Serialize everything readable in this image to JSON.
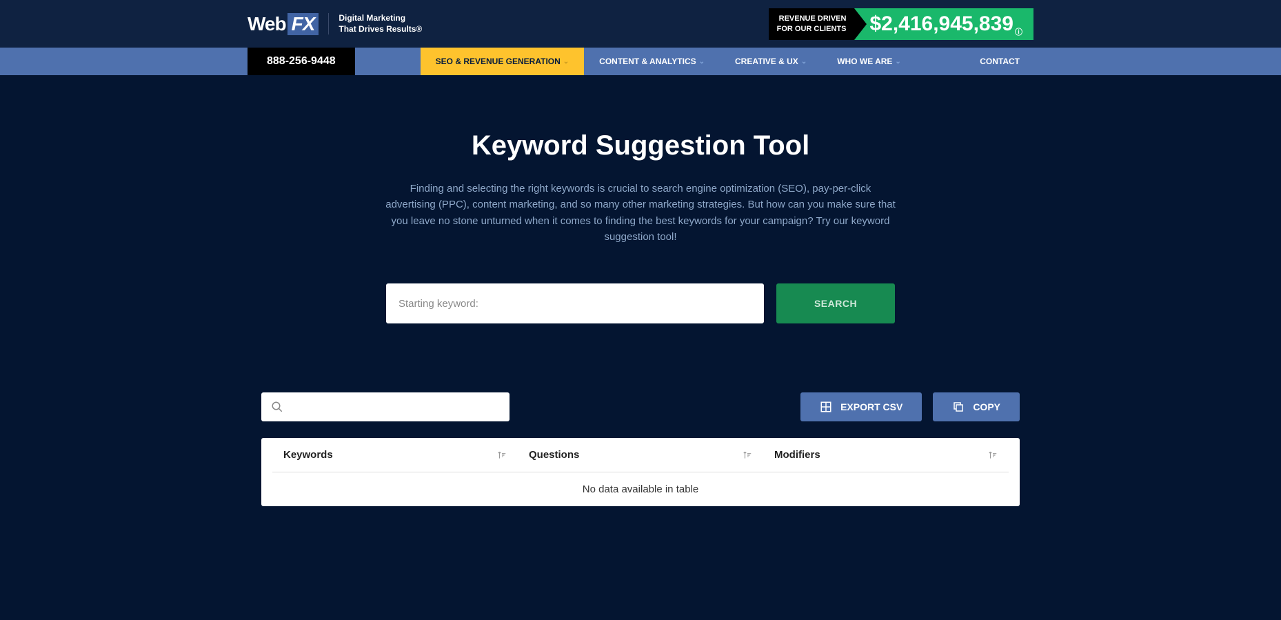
{
  "header": {
    "logo_web": "Web",
    "logo_fx": "FX",
    "tagline_line1": "Digital Marketing",
    "tagline_line2": "That Drives Results®",
    "revenue_label_line1": "REVENUE DRIVEN",
    "revenue_label_line2": "FOR OUR CLIENTS",
    "revenue_amount": "$2,416,945,839"
  },
  "nav": {
    "phone": "888-256-9448",
    "items": [
      {
        "label": "SEO & REVENUE GENERATION",
        "has_dropdown": true
      },
      {
        "label": "CONTENT & ANALYTICS",
        "has_dropdown": true
      },
      {
        "label": "CREATIVE & UX",
        "has_dropdown": true
      },
      {
        "label": "WHO WE ARE",
        "has_dropdown": true
      },
      {
        "label": "CONTACT",
        "has_dropdown": false
      }
    ]
  },
  "main": {
    "title": "Keyword Suggestion Tool",
    "description": "Finding and selecting the right keywords is crucial to search engine optimization (SEO), pay-per-click advertising (PPC), content marketing, and so many other marketing strategies. But how can you make sure that you leave no stone unturned when it comes to finding the best keywords for your campaign? Try our keyword suggestion tool!",
    "search_placeholder": "Starting keyword:",
    "search_button": "SEARCH"
  },
  "toolbar": {
    "export_label": "EXPORT CSV",
    "copy_label": "COPY"
  },
  "table": {
    "columns": [
      "Keywords",
      "Questions",
      "Modifiers"
    ],
    "no_data": "No data available in table"
  }
}
